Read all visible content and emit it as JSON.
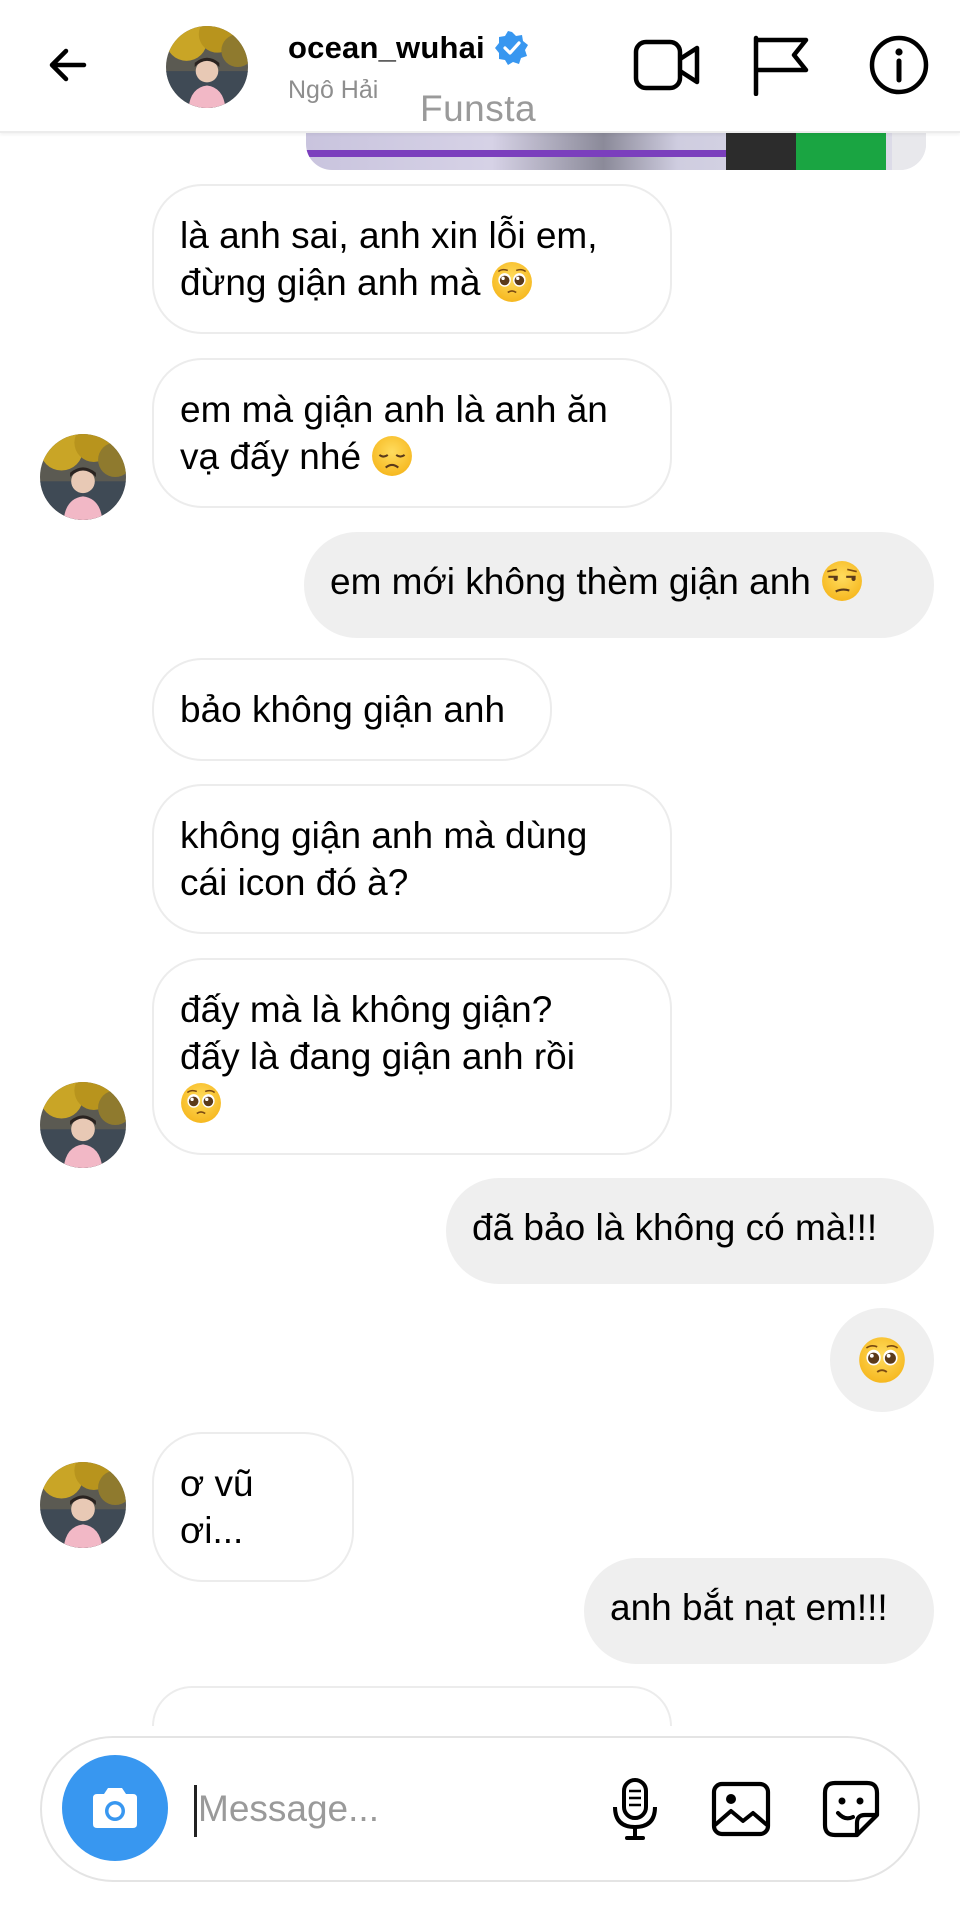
{
  "header": {
    "username": "ocean_wuhai",
    "full_name": "Ngô Hải",
    "watermark": "Funsta",
    "icons": [
      "back-arrow-icon",
      "verified-badge-icon",
      "video-call-icon",
      "flag-icon",
      "info-icon"
    ]
  },
  "messages": [
    {
      "side": "incoming",
      "lines": [
        "là anh sai, anh xin lỗi em,",
        "đừng giận anh mà"
      ],
      "emoji": "pleading-face"
    },
    {
      "side": "incoming",
      "lines": [
        "em mà giận anh là anh ăn",
        "vạ đấy nhé"
      ],
      "emoji": "disappointed-face"
    },
    {
      "side": "outgoing",
      "text": "em mới không thèm giận anh",
      "emoji": "unamused-face"
    },
    {
      "side": "incoming",
      "text": "bảo không giận anh"
    },
    {
      "side": "incoming",
      "lines": [
        "không giận anh mà dùng",
        "cái icon đó à?"
      ]
    },
    {
      "side": "incoming",
      "lines": [
        "đấy mà là không giận?",
        "đấy là đang giận anh rồi"
      ],
      "emoji": "pleading-face"
    },
    {
      "side": "outgoing",
      "text": "đã bảo là không có mà!!!"
    },
    {
      "side": "outgoing",
      "emoji": "pleading-face"
    },
    {
      "side": "incoming",
      "text": "ơ vũ ơi..."
    },
    {
      "side": "outgoing",
      "text": "anh bắt nạt em!!!"
    }
  ],
  "composer": {
    "placeholder": "Message...",
    "icons": [
      "camera-icon",
      "microphone-icon",
      "gallery-icon",
      "sticker-icon"
    ]
  },
  "colors": {
    "accent": "#3897f0",
    "outgoing_bubble": "#efefef",
    "bubble_border": "#ececec",
    "emoji_yellow": "#fbc531"
  }
}
